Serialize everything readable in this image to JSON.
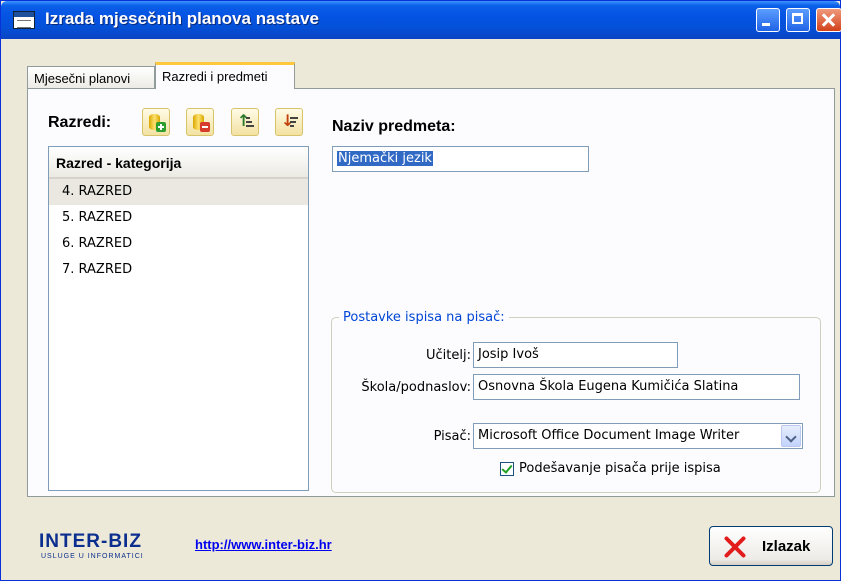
{
  "window": {
    "title": "Izrada mjesečnih planova nastave"
  },
  "tabs": [
    {
      "label": "Mjesečni planovi",
      "active": false
    },
    {
      "label": "Razredi i predmeti",
      "active": true
    }
  ],
  "classes": {
    "label": "Razredi:",
    "column_header": "Razred - kategorija",
    "rows": [
      "4. RAZRED",
      "5. RAZRED",
      "6. RAZRED",
      "7. RAZRED"
    ],
    "selected_index": 0,
    "toolbar_icons": [
      "add-record-icon",
      "delete-record-icon",
      "sort-ascending-icon",
      "sort-descending-icon"
    ]
  },
  "subject": {
    "label": "Naziv predmeta:",
    "value": "Njemački jezik"
  },
  "print_settings": {
    "legend": "Postavke ispisa na pisač:",
    "teacher_label": "Učitelj:",
    "teacher_value": "Josip Ivoš",
    "school_label": "Škola/podnaslov:",
    "school_value": "Osnovna Škola Eugena Kumičića Slatina",
    "printer_label": "Pisač:",
    "printer_value": "Microsoft Office Document Image Writer",
    "setup_label": "Podešavanje pisača prije ispisa",
    "setup_checked": true
  },
  "footer": {
    "logo_text": "INTER-BIZ",
    "logo_subtitle": "USLUGE U INFORMATICI",
    "link": "http://www.inter-biz.hr",
    "exit_label": "Izlazak"
  },
  "colors": {
    "titlebar": "#0553e3",
    "selection": "#316ac5",
    "group_legend": "#0046d5",
    "logo": "#0b2e8f"
  }
}
